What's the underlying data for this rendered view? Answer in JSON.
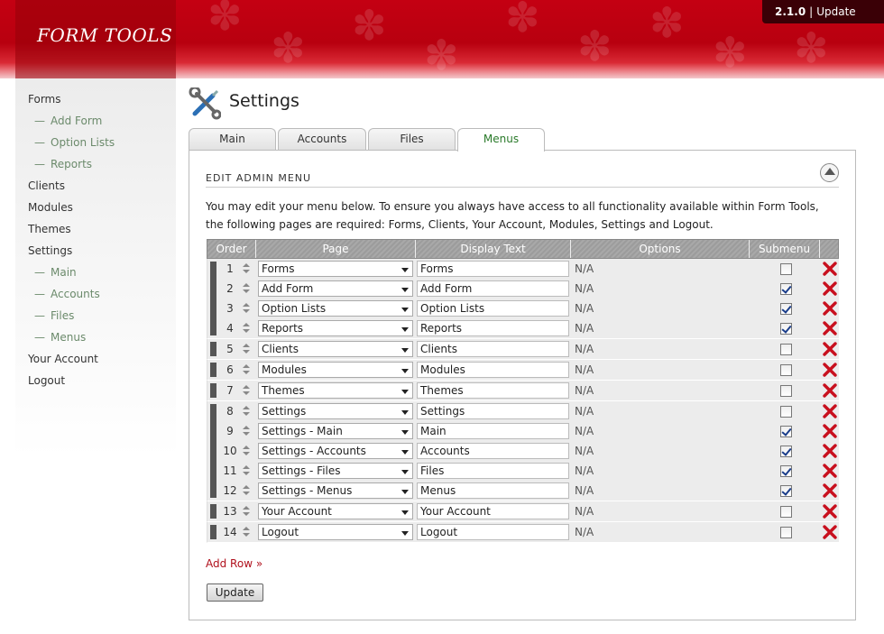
{
  "header": {
    "logo": "FORM TOOLS",
    "version": "2.1.0",
    "separator": "|",
    "update_link": "Update",
    "brand_color": "#c40012"
  },
  "sidebar": {
    "items": [
      {
        "label": "Forms",
        "sub": false
      },
      {
        "label": "Add Form",
        "sub": true
      },
      {
        "label": "Option Lists",
        "sub": true
      },
      {
        "label": "Reports",
        "sub": true
      },
      {
        "label": "Clients",
        "sub": false
      },
      {
        "label": "Modules",
        "sub": false
      },
      {
        "label": "Themes",
        "sub": false
      },
      {
        "label": "Settings",
        "sub": false
      },
      {
        "label": "Main",
        "sub": true
      },
      {
        "label": "Accounts",
        "sub": true
      },
      {
        "label": "Files",
        "sub": true
      },
      {
        "label": "Menus",
        "sub": true
      },
      {
        "label": "Your Account",
        "sub": false
      },
      {
        "label": "Logout",
        "sub": false
      }
    ],
    "dash": "—"
  },
  "page": {
    "title": "Settings",
    "icon": "wrench-screwdriver-icon",
    "tabs": [
      "Main",
      "Accounts",
      "Files",
      "Menus"
    ],
    "active_tab": "Menus"
  },
  "section": {
    "title": "EDIT ADMIN MENU",
    "intro": "You may edit your menu below. To ensure you always have access to all functionality available within Form Tools, the following pages are required: Forms, Clients, Your Account, Modules, Settings and Logout."
  },
  "table": {
    "headers": [
      "Order",
      "Page",
      "Display Text",
      "Options",
      "Submenu"
    ],
    "groups": [
      {
        "rows": [
          {
            "order": "1",
            "page": "Forms",
            "display": "Forms",
            "options": "N/A",
            "submenu": false
          },
          {
            "order": "2",
            "page": "Add Form",
            "display": "Add Form",
            "options": "N/A",
            "submenu": true
          },
          {
            "order": "3",
            "page": "Option Lists",
            "display": "Option Lists",
            "options": "N/A",
            "submenu": true
          },
          {
            "order": "4",
            "page": "Reports",
            "display": "Reports",
            "options": "N/A",
            "submenu": true
          }
        ]
      },
      {
        "rows": [
          {
            "order": "5",
            "page": "Clients",
            "display": "Clients",
            "options": "N/A",
            "submenu": false
          }
        ]
      },
      {
        "rows": [
          {
            "order": "6",
            "page": "Modules",
            "display": "Modules",
            "options": "N/A",
            "submenu": false
          }
        ]
      },
      {
        "rows": [
          {
            "order": "7",
            "page": "Themes",
            "display": "Themes",
            "options": "N/A",
            "submenu": false
          }
        ]
      },
      {
        "rows": [
          {
            "order": "8",
            "page": "Settings",
            "display": "Settings",
            "options": "N/A",
            "submenu": false
          },
          {
            "order": "9",
            "page": "Settings - Main",
            "display": "Main",
            "options": "N/A",
            "submenu": true
          },
          {
            "order": "10",
            "page": "Settings - Accounts",
            "display": "Accounts",
            "options": "N/A",
            "submenu": true
          },
          {
            "order": "11",
            "page": "Settings - Files",
            "display": "Files",
            "options": "N/A",
            "submenu": true
          },
          {
            "order": "12",
            "page": "Settings - Menus",
            "display": "Menus",
            "options": "N/A",
            "submenu": true
          }
        ]
      },
      {
        "rows": [
          {
            "order": "13",
            "page": "Your Account",
            "display": "Your Account",
            "options": "N/A",
            "submenu": false
          }
        ]
      },
      {
        "rows": [
          {
            "order": "14",
            "page": "Logout",
            "display": "Logout",
            "options": "N/A",
            "submenu": false
          }
        ]
      }
    ]
  },
  "actions": {
    "add_row": "Add Row »",
    "update": "Update",
    "delete_color": "#c8101e"
  }
}
